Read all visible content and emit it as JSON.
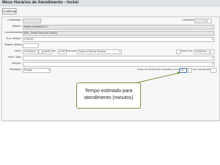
{
  "window": {
    "title": "Meus Horários de Atendimento - Incluir"
  },
  "toolbar": {
    "confirm_label": "Confirmar"
  },
  "form": {
    "localizacao": {
      "label": "Localização:",
      "value": ""
    },
    "medico": {
      "label": "Médico:",
      "value": "Medico Ambulatório 1.2"
    },
    "local": {
      "label": "Local Atendimento:",
      "value": "(500 - Teófilo Otoni) (AG-00007)"
    },
    "proc": {
      "label": "Proc. Médico:",
      "value": "(720103)"
    },
    "rastr": {
      "label": "Rastrei. Médico:",
      "value": ""
    },
    "inicio": {
      "label": "Início:",
      "date": "11/10/2012",
      "time_from": "08:00",
      "ate_label": "até",
      "time_to": "10:00",
      "repeticao_label": "Repetição:",
      "repeticao_value": "Todos os Dias da Semana",
      "repetir_ate_label": "Repetir Até:",
      "repetir_ate_value": "11/10/2012"
    },
    "setor": {
      "label": "Setor / Sala:",
      "value": ""
    },
    "selecao": {
      "label": "Seleção:",
      "value": ""
    },
    "prioridade": {
      "label": "Prioridade:",
      "value": "Privado",
      "tempo_label": "Tempo de Atendimento estimativa em minutos:",
      "tempo_value": "15",
      "qtd_label": "Qtd. Ingr/atendentes:",
      "qtd_value": ""
    },
    "cancelado": {
      "label": "Cancelado:"
    }
  },
  "callout": {
    "text": "Tempo estimado para atendimento (minutos)"
  },
  "colors": {
    "callout_border": "#6f8a36",
    "highlight": "#3a6fb5"
  }
}
